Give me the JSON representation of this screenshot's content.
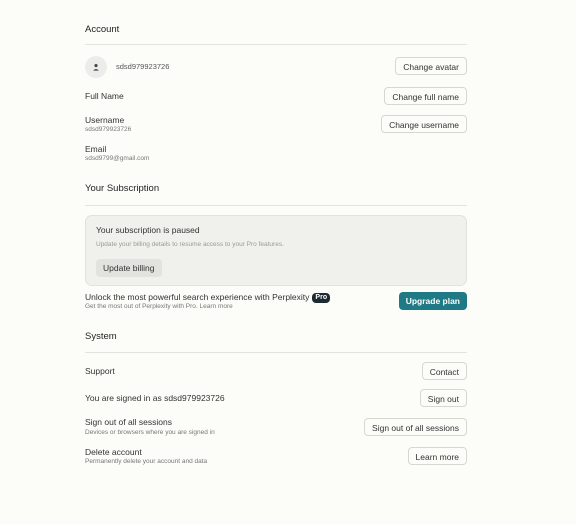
{
  "account": {
    "title": "Account",
    "avatar_name": "sdsd979923726",
    "change_avatar": "Change avatar",
    "full_name_label": "Full Name",
    "change_full_name": "Change full name",
    "username_label": "Username",
    "username_value": "sdsd979923726",
    "change_username": "Change username",
    "email_label": "Email",
    "email_value": "sdsd9799@gmail.com"
  },
  "subscription": {
    "title": "Your Subscription",
    "paused_title": "Your subscription is paused",
    "paused_desc": "Update your billing details to resume access to your Pro features.",
    "update_billing": "Update billing",
    "unlock_text": "Unlock the most powerful search experience with Perplexity",
    "pro_badge": "Pro",
    "unlock_sub": "Get the most out of Perplexity with Pro. Learn more",
    "upgrade": "Upgrade plan"
  },
  "system": {
    "title": "System",
    "support_label": "Support",
    "contact": "Contact",
    "signed_in": "You are signed in as sdsd979923726",
    "sign_out": "Sign out",
    "sign_out_all_label": "Sign out of all sessions",
    "sign_out_all_sub": "Devices or browsers where you are signed in",
    "sign_out_all": "Sign out of all sessions",
    "delete_label": "Delete account",
    "delete_sub": "Permanently delete your account and data",
    "learn_more": "Learn more"
  },
  "colors": {
    "accent": "#1f7a86",
    "background": "#fcfcf9"
  }
}
